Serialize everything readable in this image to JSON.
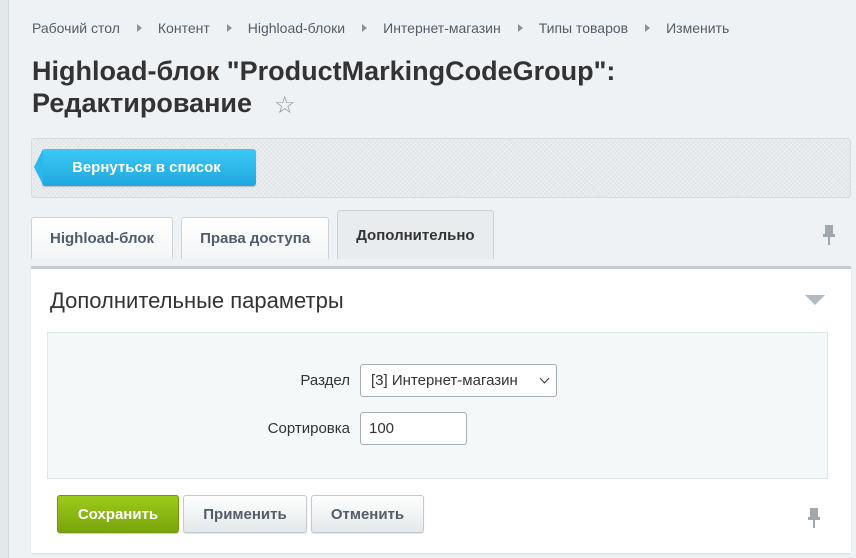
{
  "breadcrumb": [
    {
      "label": "Рабочий стол"
    },
    {
      "label": "Контент"
    },
    {
      "label": "Highload-блоки"
    },
    {
      "label": "Интернет-магазин"
    },
    {
      "label": "Типы товаров"
    },
    {
      "label": "Изменить"
    }
  ],
  "page": {
    "title": "Highload-блок \"ProductMarkingCodeGroup\": Редактирование",
    "favorite_icon": "star-icon"
  },
  "toolbar": {
    "back_label": "Вернуться в список"
  },
  "tabs": [
    {
      "label": "Highload-блок",
      "active": false
    },
    {
      "label": "Права доступа",
      "active": false
    },
    {
      "label": "Дополнительно",
      "active": true
    }
  ],
  "section": {
    "title": "Дополнительные параметры",
    "collapse_icon": "triangle-down-icon"
  },
  "form": {
    "section_label": "Раздел",
    "section_value": "[3] Интернет-магазин",
    "sort_label": "Сортировка",
    "sort_value": "100"
  },
  "actions": {
    "save_label": "Сохранить",
    "apply_label": "Применить",
    "cancel_label": "Отменить"
  },
  "colors": {
    "back_button": "#2fb6ea",
    "save_button": "#8bbb12",
    "background": "#eef2f4"
  }
}
